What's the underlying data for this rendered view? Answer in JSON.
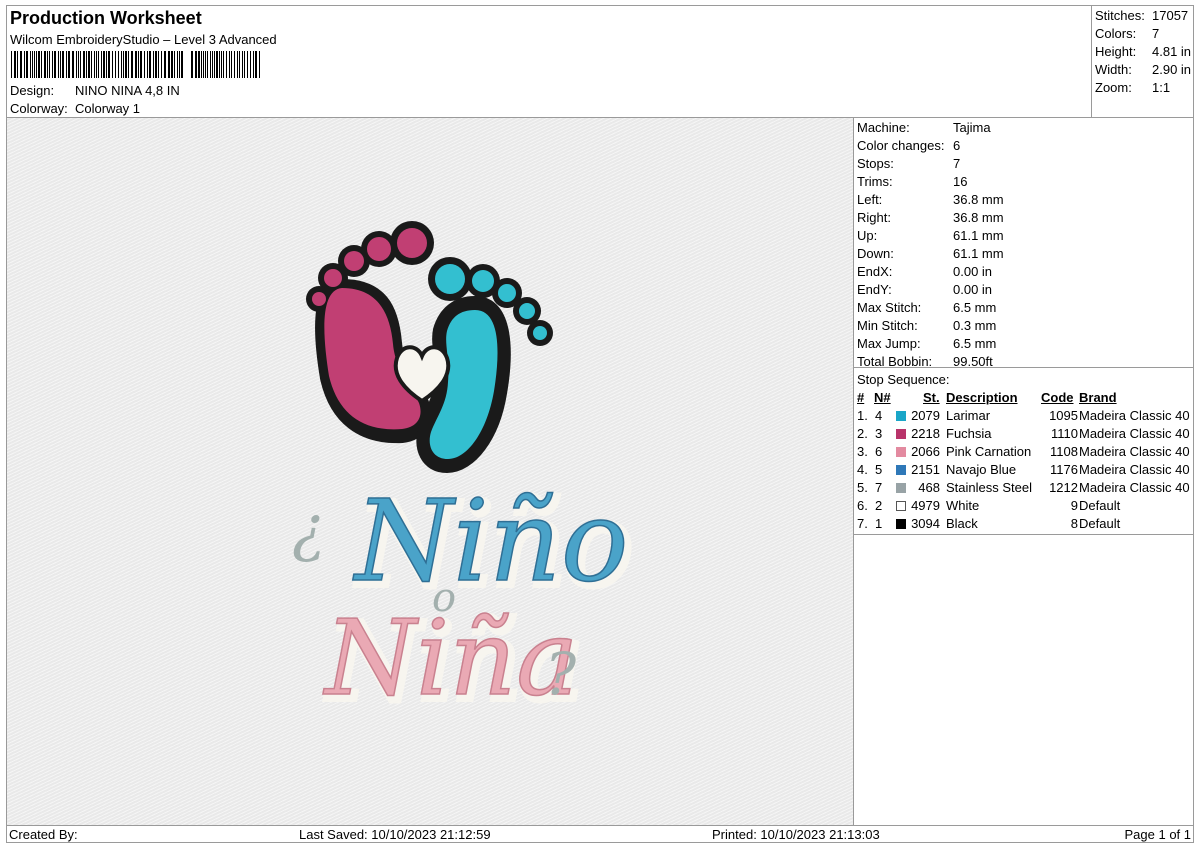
{
  "header": {
    "title": "Production Worksheet",
    "subtitle": "Wilcom EmbroideryStudio – Level 3 Advanced",
    "design_label": "Design:",
    "design_value": "NINO NINA 4,8 IN",
    "colorway_label": "Colorway:",
    "colorway_value": "Colorway 1"
  },
  "summary": [
    {
      "label": "Stitches:",
      "value": "17057"
    },
    {
      "label": "Colors:",
      "value": "7"
    },
    {
      "label": "Height:",
      "value": "4.81 in"
    },
    {
      "label": "Width:",
      "value": "2.90 in"
    },
    {
      "label": "Zoom:",
      "value": "1:1"
    }
  ],
  "design_text": {
    "q_open": "¿",
    "line1": "Niño",
    "line2": "o",
    "line3": "Niña",
    "q_close": "?"
  },
  "properties": [
    {
      "label": "Machine:",
      "value": "Tajima"
    },
    {
      "label": "Color changes:",
      "value": "6"
    },
    {
      "label": "Stops:",
      "value": "7"
    },
    {
      "label": "Trims:",
      "value": "16"
    },
    {
      "label": "Left:",
      "value": "36.8 mm"
    },
    {
      "label": "Right:",
      "value": "36.8 mm"
    },
    {
      "label": "Up:",
      "value": "61.1 mm"
    },
    {
      "label": "Down:",
      "value": "61.1 mm"
    },
    {
      "label": "EndX:",
      "value": "0.00 in"
    },
    {
      "label": "EndY:",
      "value": "0.00 in"
    },
    {
      "label": "Max Stitch:",
      "value": "6.5 mm"
    },
    {
      "label": "Min Stitch:",
      "value": "0.3 mm"
    },
    {
      "label": "Max Jump:",
      "value": "6.5 mm"
    },
    {
      "label": "Total Bobbin:",
      "value": "99.50ft"
    }
  ],
  "stop_sequence": {
    "title": "Stop Sequence:",
    "headers": {
      "num": "#",
      "n": "N#",
      "st": "St.",
      "description": "Description",
      "code": "Code",
      "brand": "Brand"
    },
    "rows": [
      {
        "num": "1.",
        "n": "4",
        "st": "2079",
        "color": "#1aa6c8",
        "description": "Larimar",
        "code": "1095",
        "brand": "Madeira Classic 40"
      },
      {
        "num": "2.",
        "n": "3",
        "st": "2218",
        "color": "#b8336a",
        "description": "Fuchsia",
        "code": "1110",
        "brand": "Madeira Classic 40"
      },
      {
        "num": "3.",
        "n": "6",
        "st": "2066",
        "color": "#e38aa0",
        "description": "Pink Carnation",
        "code": "1108",
        "brand": "Madeira Classic 40"
      },
      {
        "num": "4.",
        "n": "5",
        "st": "2151",
        "color": "#2f78b8",
        "description": "Navajo Blue",
        "code": "1176",
        "brand": "Madeira Classic 40"
      },
      {
        "num": "5.",
        "n": "7",
        "st": "468",
        "color": "#98a3a6",
        "description": "Stainless Steel",
        "code": "1212",
        "brand": "Madeira Classic 40"
      },
      {
        "num": "6.",
        "n": "2",
        "st": "4979",
        "color": "#ffffff",
        "description": "White",
        "code": "9",
        "brand": "Default"
      },
      {
        "num": "7.",
        "n": "1",
        "st": "3094",
        "color": "#000000",
        "description": "Black",
        "code": "8",
        "brand": "Default"
      }
    ]
  },
  "footer": {
    "created_by": "Created By:",
    "last_saved": "Last Saved: 10/10/2023 21:12:59",
    "printed": "Printed: 10/10/2023 21:13:03",
    "page": "Page 1 of 1"
  },
  "colors": {
    "fuchsia": "#c13f73",
    "larimar": "#33bfd0",
    "navajo_blue": "#4aa3c9",
    "pink_carnation": "#eaa9b4",
    "steel": "#a3b0ae",
    "black": "#1a1a1a",
    "white": "#f7f5ef"
  }
}
